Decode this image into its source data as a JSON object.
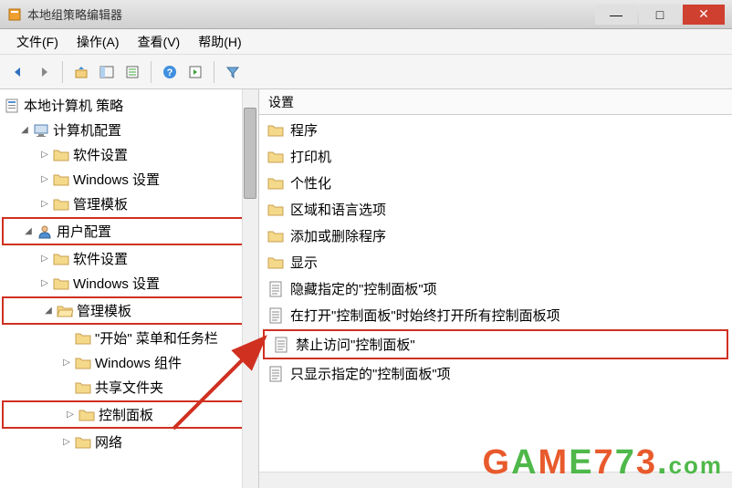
{
  "window": {
    "title": "本地组策略编辑器"
  },
  "menu": {
    "file": "文件(F)",
    "action": "操作(A)",
    "view": "查看(V)",
    "help": "帮助(H)"
  },
  "tree": {
    "root": "本地计算机 策略",
    "computer_config": "计算机配置",
    "software_settings_1": "软件设置",
    "windows_settings_1": "Windows 设置",
    "admin_templates_1": "管理模板",
    "user_config": "用户配置",
    "software_settings_2": "软件设置",
    "windows_settings_2": "Windows 设置",
    "admin_templates_2": "管理模板",
    "start_menu": "\"开始\" 菜单和任务栏",
    "windows_components": "Windows 组件",
    "shared_folders": "共享文件夹",
    "control_panel": "控制面板",
    "network": "网络"
  },
  "list": {
    "header": "设置",
    "items": [
      {
        "type": "folder",
        "label": "程序"
      },
      {
        "type": "folder",
        "label": "打印机"
      },
      {
        "type": "folder",
        "label": "个性化"
      },
      {
        "type": "folder",
        "label": "区域和语言选项"
      },
      {
        "type": "folder",
        "label": "添加或删除程序"
      },
      {
        "type": "folder",
        "label": "显示"
      },
      {
        "type": "policy",
        "label": "隐藏指定的\"控制面板\"项"
      },
      {
        "type": "policy",
        "label": "在打开\"控制面板\"时始终打开所有控制面板项"
      },
      {
        "type": "policy",
        "label": "禁止访问\"控制面板\"",
        "highlighted": true
      },
      {
        "type": "policy",
        "label": "只显示指定的\"控制面板\"项"
      }
    ]
  },
  "watermark": "GAME773.com"
}
